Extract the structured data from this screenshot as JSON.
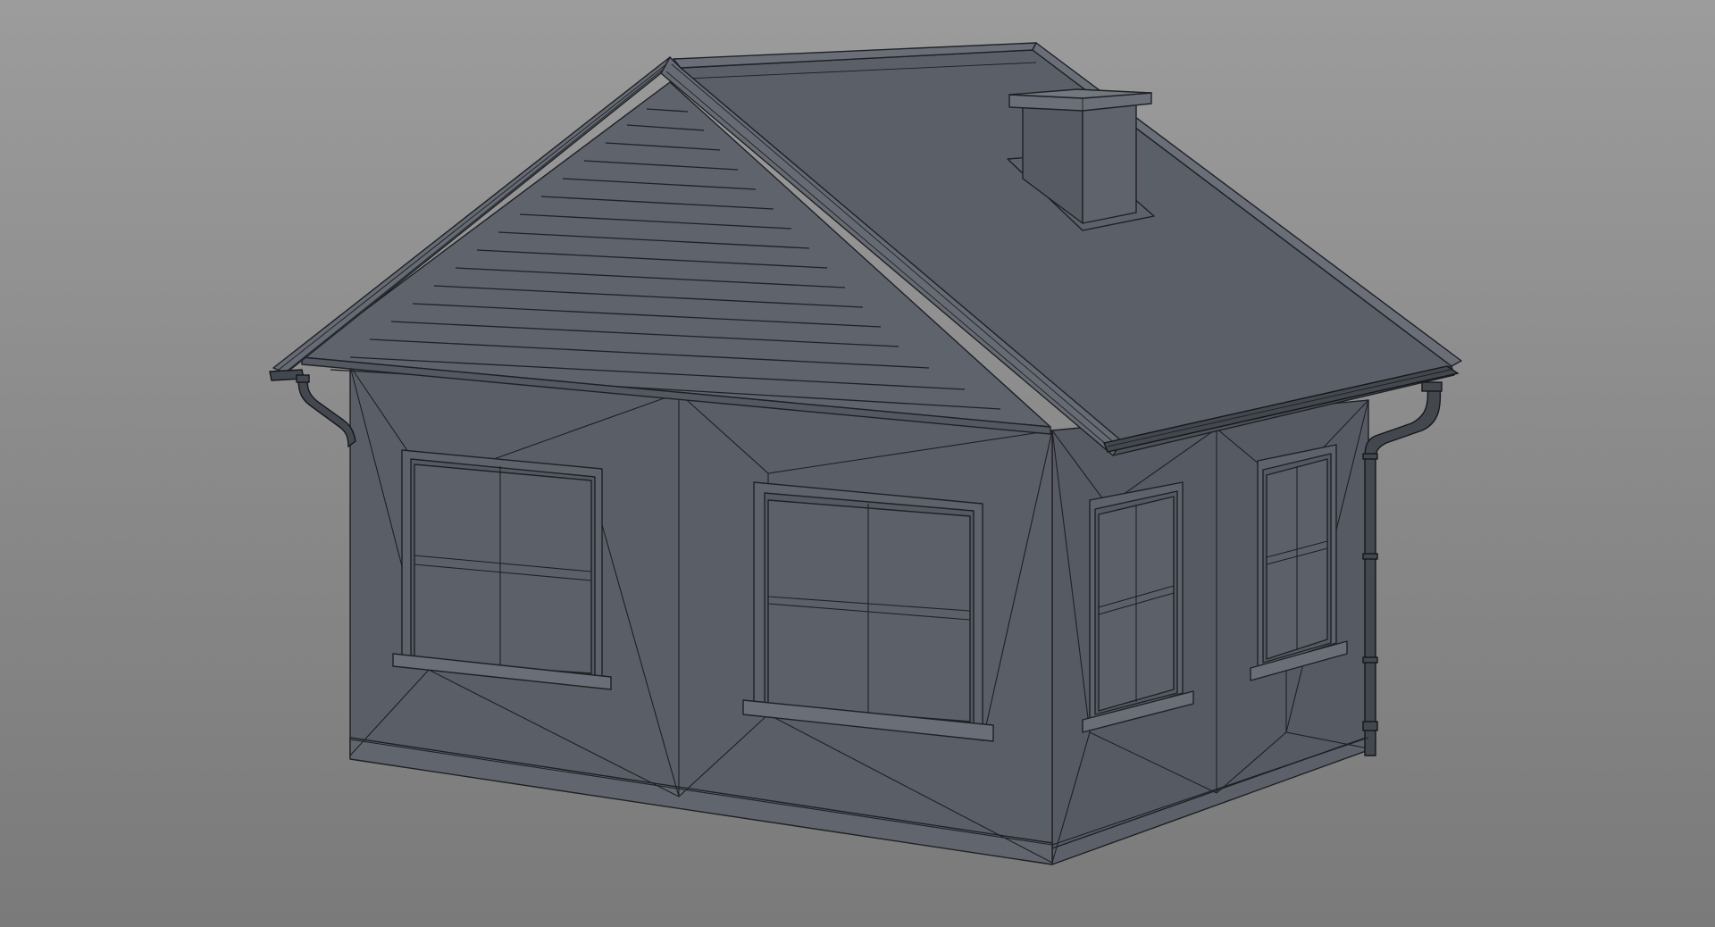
{
  "viewport": {
    "background_top": "#9c9c9c",
    "background_bottom": "#7a7a7a",
    "shaded_face_color": "#5a5f67",
    "wire_color": "#1e2024"
  },
  "model": {
    "object": "cottage-house",
    "shading": "shaded-with-wireframe",
    "parts": [
      "main-wall-front",
      "side-wall-right",
      "gable-siding",
      "roof-right",
      "roof-trim",
      "chimney",
      "windows",
      "window-sills",
      "gutters",
      "downpipes",
      "plinth"
    ]
  }
}
